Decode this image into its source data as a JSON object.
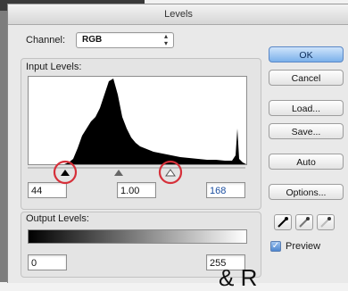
{
  "window": {
    "title": "Levels"
  },
  "channel": {
    "label": "Channel:",
    "value": "RGB"
  },
  "input_levels": {
    "label": "Input Levels:",
    "black": "44",
    "gamma": "1.00",
    "white": "168",
    "black_level": 44,
    "gamma_level": 1.0,
    "white_level": 168
  },
  "output_levels": {
    "label": "Output Levels:",
    "black": "0",
    "white": "255",
    "black_level": 0,
    "white_level": 255
  },
  "buttons": {
    "ok": "OK",
    "cancel": "Cancel",
    "load": "Load...",
    "save": "Save...",
    "auto": "Auto",
    "options": "Options..."
  },
  "preview": {
    "label": "Preview",
    "checked": true
  },
  "colors": {
    "accent": "#7bb0ea",
    "annotation": "#d6303a",
    "selected_text": "#1c4fa1"
  },
  "icons": [
    "up-down-arrows-icon",
    "black-eyedropper-icon",
    "gray-eyedropper-icon",
    "white-eyedropper-icon",
    "checkmark-icon"
  ],
  "caption": "& R"
}
